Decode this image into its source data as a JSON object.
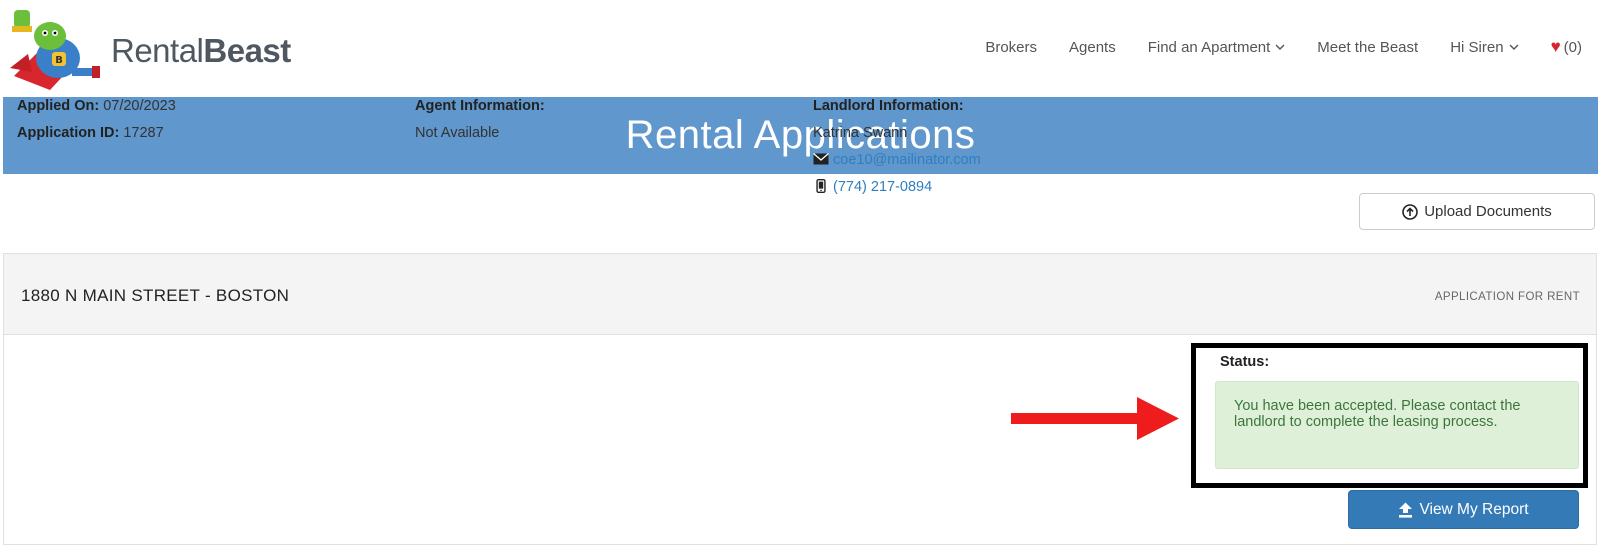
{
  "brand": {
    "name_light": "Rental",
    "name_bold": "Beast"
  },
  "nav": {
    "items": [
      "Brokers",
      "Agents",
      "Find an Apartment",
      "Meet the Beast",
      "Hi Siren"
    ],
    "favorites_count": "(0)"
  },
  "banner": {
    "title": "Rental Applications"
  },
  "upload_button": {
    "label": "Upload Documents"
  },
  "application": {
    "address": "1880 N MAIN STREET - BOSTON",
    "type": "APPLICATION FOR RENT",
    "applied_on_label": "Applied On:",
    "applied_on": "07/20/2023",
    "application_id_label": "Application ID:",
    "application_id": "17287",
    "agent_label": "Agent Information:",
    "agent_value": "Not Available",
    "landlord_label": "Landlord Information:",
    "landlord_name": "Katrina Swann",
    "landlord_email": "coe10@mailinator.com",
    "landlord_phone": "(774) 217-0894",
    "status_label": "Status:",
    "status_message": "You have been accepted. Please contact the landlord to complete the leasing process."
  },
  "report_button": {
    "label": "View My Report"
  },
  "colors": {
    "banner": "#6097cd",
    "primary_button": "#337ab7",
    "alert_bg": "#dff0d8",
    "alert_text": "#3c763d",
    "link": "#2f7fbf",
    "heart": "#d9232e"
  }
}
